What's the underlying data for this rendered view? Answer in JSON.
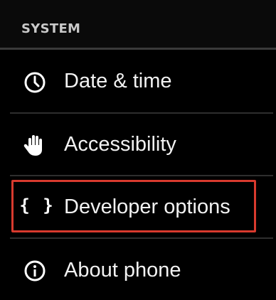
{
  "section": {
    "title": "SYSTEM"
  },
  "items": [
    {
      "label": "Date & time",
      "icon": "clock-icon"
    },
    {
      "label": "Accessibility",
      "icon": "hand-icon"
    },
    {
      "label": "Developer options",
      "icon": "braces-icon",
      "glyph": "{ }"
    },
    {
      "label": "About phone",
      "icon": "info-icon"
    }
  ],
  "colors": {
    "background": "#000000",
    "header_text": "#c9c9c9",
    "item_text": "#f2f2f2",
    "highlight_border": "#d83a2e",
    "divider": "#2e2e2e"
  }
}
